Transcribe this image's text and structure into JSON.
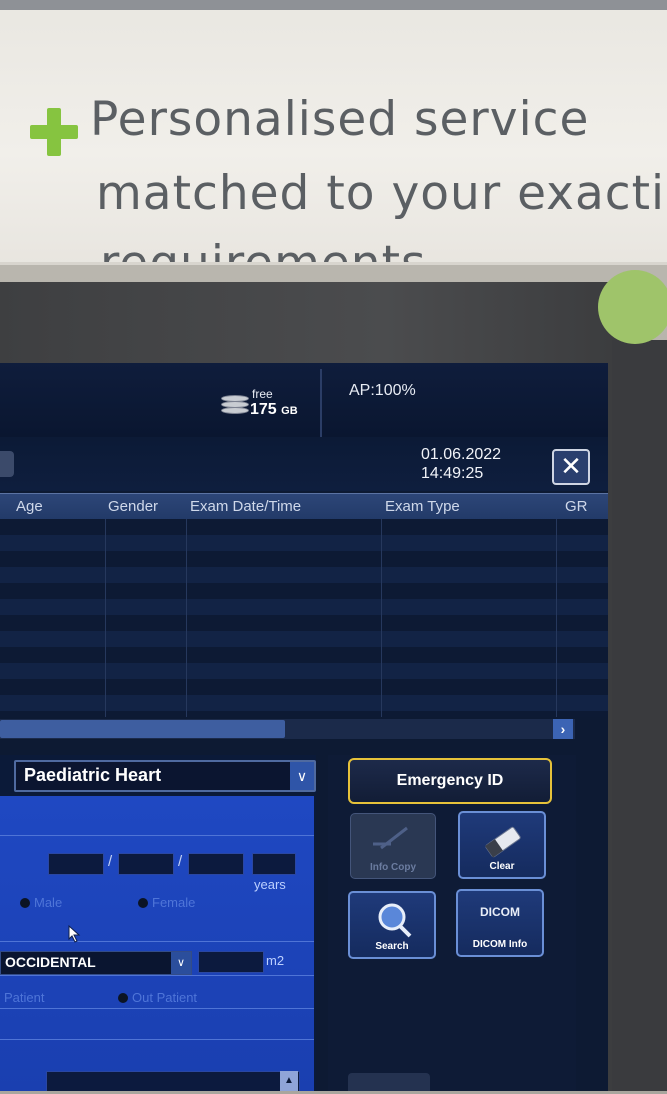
{
  "poster": {
    "line1": "Personalised service",
    "line2": "matched to your exactin",
    "line3": "requirements"
  },
  "status": {
    "free_label": "free",
    "free_value": "175",
    "free_unit": "GB",
    "ap": "AP:100%"
  },
  "datetime": {
    "date": "01.06.2022",
    "time": "14:49:25",
    "close_glyph": "✕"
  },
  "table": {
    "columns": [
      "Age",
      "Gender",
      "Exam Date/Time",
      "Exam Type",
      "GR"
    ]
  },
  "scroll": {
    "right_glyph": "›"
  },
  "form": {
    "exam_type": "Paediatric Heart",
    "dob_sep": "/",
    "years_label": "years",
    "male_label": "Male",
    "female_label": "Female",
    "ethnicity": "OCCIDENTAL",
    "bsa_unit": "m2",
    "in_patient_label": "Patient",
    "out_patient_label": "Out Patient",
    "dropdown_glyph": "∨"
  },
  "buttons": {
    "emergency_id": "Emergency ID",
    "info_copy": "Info Copy",
    "clear": "Clear",
    "search": "Search",
    "dicom_glyph": "DICOM",
    "dicom_info": "DICOM Info"
  },
  "colors": {
    "accent_yellow": "#e6c23a",
    "form_blue": "#1f48c2",
    "poster_green": "#86c440"
  }
}
